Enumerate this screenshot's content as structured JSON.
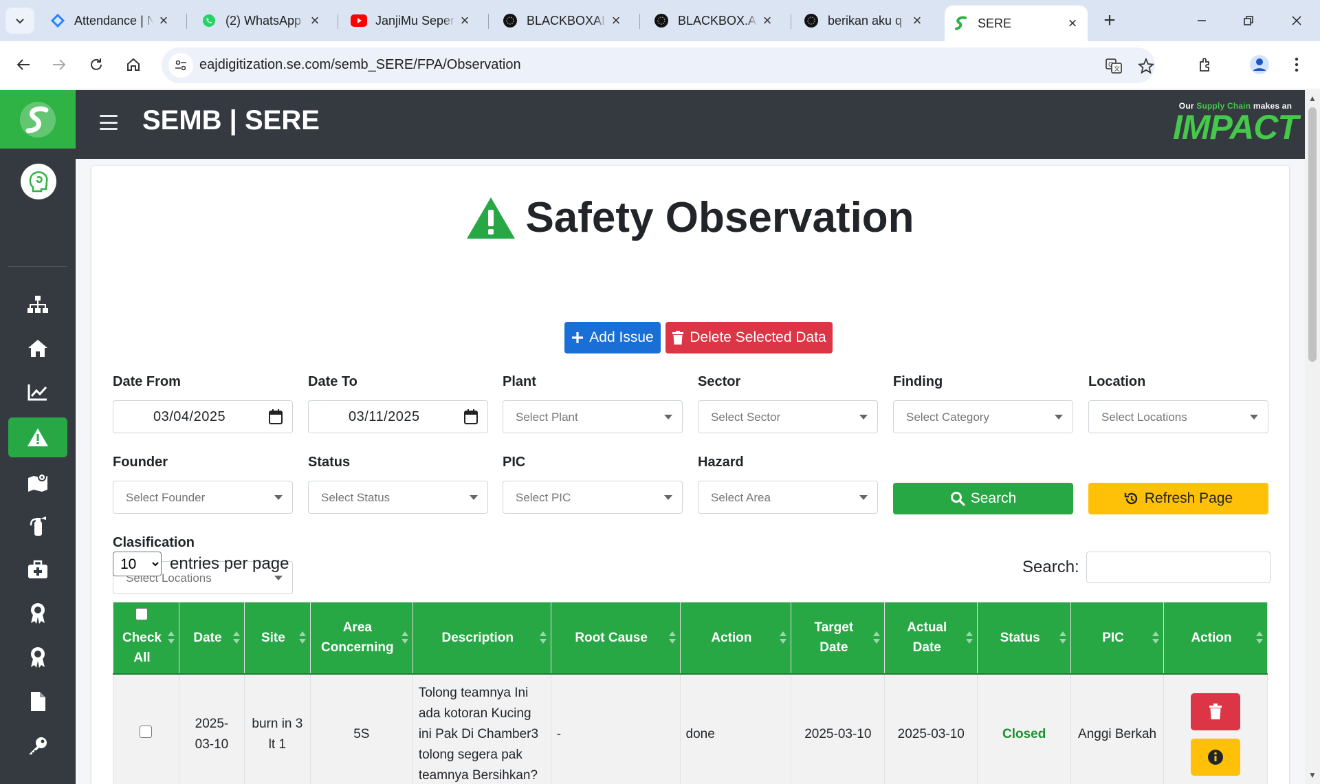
{
  "browser": {
    "tabs": [
      {
        "label": "Attendance | N",
        "favicon": "jira-icon",
        "color": "#2684ff"
      },
      {
        "label": "(2) WhatsApp",
        "favicon": "whatsapp-icon",
        "color": "#25d366"
      },
      {
        "label": "JanjiMu Seper",
        "favicon": "youtube-icon",
        "color": "#ff0000"
      },
      {
        "label": "BLACKBOXAI",
        "favicon": "blackbox-icon",
        "color": "#111111"
      },
      {
        "label": "BLACKBOX.AI",
        "favicon": "blackbox-icon",
        "color": "#111111"
      },
      {
        "label": "berikan aku q",
        "favicon": "blackbox-icon",
        "color": "#111111"
      },
      {
        "label": "SERE",
        "favicon": "sere-icon",
        "color": "#2fb344"
      }
    ],
    "url": "eajdigitization.se.com/semb_SERE/FPA/Observation"
  },
  "app": {
    "title": "SEMB | SERE",
    "impact_tag_prefix": "Our",
    "impact_tag_green": "Supply Chain",
    "impact_tag_suffix": "makes an",
    "impact_word": "IMPACT",
    "brand_color": "#2fb344"
  },
  "sidebar": {
    "items": [
      {
        "icon": "sitemap-icon"
      },
      {
        "icon": "home-icon"
      },
      {
        "icon": "chart-line-icon"
      },
      {
        "icon": "warning-icon",
        "active": true
      },
      {
        "icon": "map-location-icon"
      },
      {
        "icon": "fire-extinguisher-icon"
      },
      {
        "icon": "first-aid-kit-icon"
      },
      {
        "icon": "award-icon"
      },
      {
        "icon": "award-icon"
      },
      {
        "icon": "document-icon"
      },
      {
        "icon": "key-icon"
      }
    ]
  },
  "page": {
    "title": "Safety Observation",
    "add_issue": "Add Issue",
    "delete_selected": "Delete Selected Data"
  },
  "filters": {
    "date_from": {
      "label": "Date From",
      "value": "03/04/2025"
    },
    "date_to": {
      "label": "Date To",
      "value": "03/11/2025"
    },
    "plant": {
      "label": "Plant",
      "placeholder": "Select Plant"
    },
    "sector": {
      "label": "Sector",
      "placeholder": "Select Sector"
    },
    "finding": {
      "label": "Finding",
      "placeholder": "Select Category"
    },
    "location": {
      "label": "Location",
      "placeholder": "Select Locations"
    },
    "founder": {
      "label": "Founder",
      "placeholder": "Select Founder"
    },
    "status": {
      "label": "Status",
      "placeholder": "Select Status"
    },
    "pic": {
      "label": "PIC",
      "placeholder": "Select PIC"
    },
    "hazard": {
      "label": "Hazard",
      "placeholder": "Select Area"
    },
    "clasification": {
      "label": "Clasification",
      "placeholder": "Select Locations"
    },
    "search_button": "Search",
    "refresh_button": "Refresh Page"
  },
  "table": {
    "entries_value": "10",
    "entries_label": "entries per page",
    "search_label": "Search:",
    "headers": {
      "check_all_1": "Check",
      "check_all_2": "All",
      "date": "Date",
      "site": "Site",
      "area_1": "Area",
      "area_2": "Concerning",
      "description": "Description",
      "root_cause": "Root Cause",
      "action": "Action",
      "target_1": "Target",
      "target_2": "Date",
      "actual_1": "Actual",
      "actual_2": "Date",
      "status": "Status",
      "pic": "PIC",
      "action_col": "Action"
    },
    "rows": [
      {
        "date_1": "2025-",
        "date_2": "03-10",
        "site_1": "burn in 3",
        "site_2": "lt 1",
        "area": "5S",
        "description": "Tolong teamnya Ini ada kotoran Kucing ini Pak Di Chamber3 tolong segera pak teamnya Bersihkan?",
        "root_cause": "-",
        "action": "done",
        "target_date": "2025-03-10",
        "actual_date": "2025-03-10",
        "status": "Closed",
        "pic": "Anggi Berkah"
      }
    ]
  }
}
